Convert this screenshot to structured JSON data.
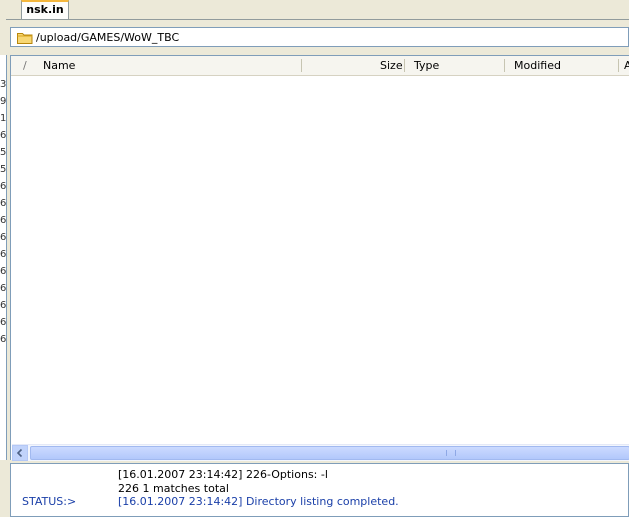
{
  "tabs": [
    {
      "label": "nsk.in"
    }
  ],
  "path": {
    "value": "/upload/GAMES/WoW_TBC"
  },
  "columns": {
    "sort": "/",
    "name": "Name",
    "size": "Size",
    "type": "Type",
    "modified": "Modified",
    "attrs": "A"
  },
  "left_pane_chars": [
    "3",
    "9",
    "1",
    "6",
    "5",
    "5",
    "6",
    "6",
    "6",
    "6",
    "6",
    "6",
    "6",
    "6",
    "6",
    "6"
  ],
  "log": [
    {
      "prefix": "",
      "text": "[16.01.2007 23:14:42] 226-Options: -l"
    },
    {
      "prefix": "",
      "text": "226 1 matches total"
    },
    {
      "prefix": "STATUS:>",
      "text": "[16.01.2007 23:14:42] Directory listing completed."
    }
  ],
  "icons": {
    "folder": "folder-icon",
    "scroll_left": "arrow-left-icon",
    "grip": "grip-icon"
  },
  "colors": {
    "tab_accent": "#f4b73d",
    "status_text": "#1a3fa8",
    "border": "#7f9db9"
  }
}
